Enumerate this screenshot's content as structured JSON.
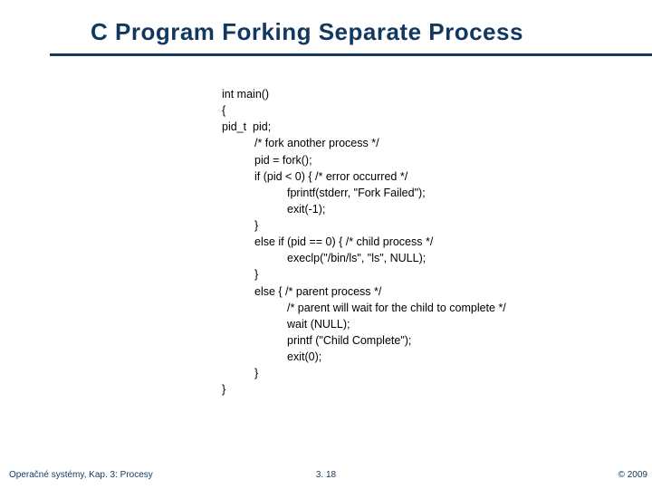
{
  "slide": {
    "title": "C Program Forking Separate Process",
    "code": {
      "l0": "int main()",
      "l1": "{",
      "l2": "pid_t  pid;",
      "l3": "/* fork another process */",
      "l4": "pid = fork();",
      "l5": "if (pid < 0) { /* error occurred */",
      "l6": "fprintf(stderr, \"Fork Failed\");",
      "l7": "exit(-1);",
      "l8": "}",
      "l9": "else if (pid == 0) { /* child process */",
      "l10": "execlp(\"/bin/ls\", \"ls\", NULL);",
      "l11": "}",
      "l12": "else { /* parent process */",
      "l13": "/* parent will wait for the child to complete */",
      "l14": "wait (NULL);",
      "l15": "printf (\"Child Complete\");",
      "l16": "exit(0);",
      "l17": "}",
      "l18": "}"
    },
    "footer": {
      "left": "Operačné systémy, Kap. 3: Procesy",
      "center": "3. 18",
      "right": "© 2009"
    }
  }
}
